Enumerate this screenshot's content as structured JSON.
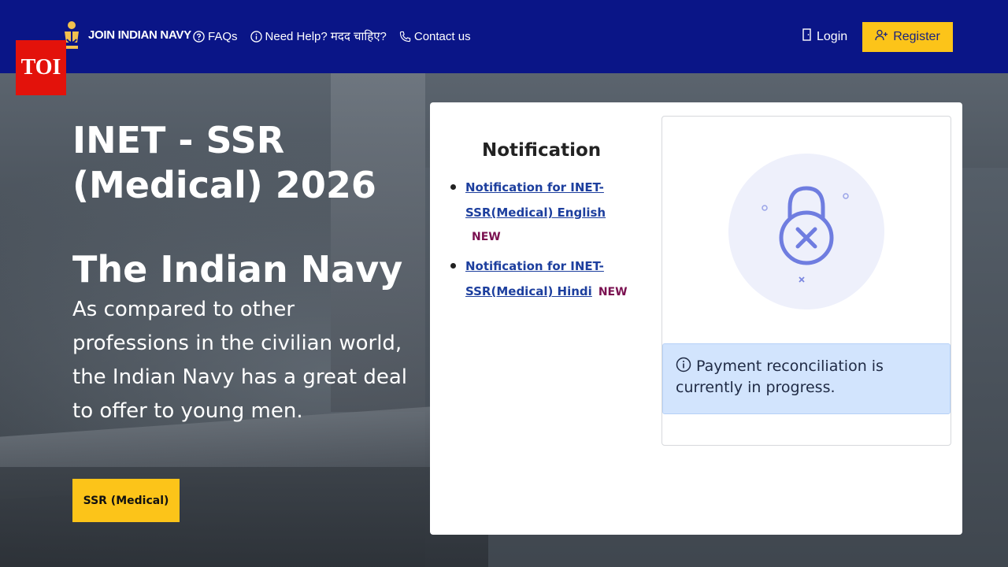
{
  "header": {
    "brand": "JOIN INDIAN NAVY",
    "nav": [
      {
        "label": "FAQs",
        "icon": "question-circle-icon"
      },
      {
        "label": "Need Help? मदद चाहिए?",
        "icon": "info-circle-icon"
      },
      {
        "label": "Contact us",
        "icon": "phone-icon"
      }
    ],
    "login_label": "Login",
    "register_label": "Register"
  },
  "badge": {
    "label": "TOI",
    "color": "#e3120b"
  },
  "hero": {
    "title": "INET - SSR (Medical) 2026",
    "subtitle": "The Indian Navy",
    "description": "As compared to other professions in the civilian world, the Indian Navy has a great deal to offer to young men.",
    "cta_label": "SSR (Medical)"
  },
  "notifications": {
    "title": "Notification",
    "items": [
      {
        "label": "Notification for INET-SSR(Medical) English",
        "badge": "NEW"
      },
      {
        "label": "Notification for INET-SSR(Medical) Hindi",
        "badge": "NEW"
      }
    ]
  },
  "status_card": {
    "icon": "locked-error-icon",
    "message": "Payment reconciliation is currently in progress."
  },
  "colors": {
    "header_bg": "#0a1587",
    "accent_yellow": "#fcc419",
    "link_blue": "#1d3f9e",
    "new_badge": "#7a1050",
    "alert_bg": "#d2e4fd"
  }
}
